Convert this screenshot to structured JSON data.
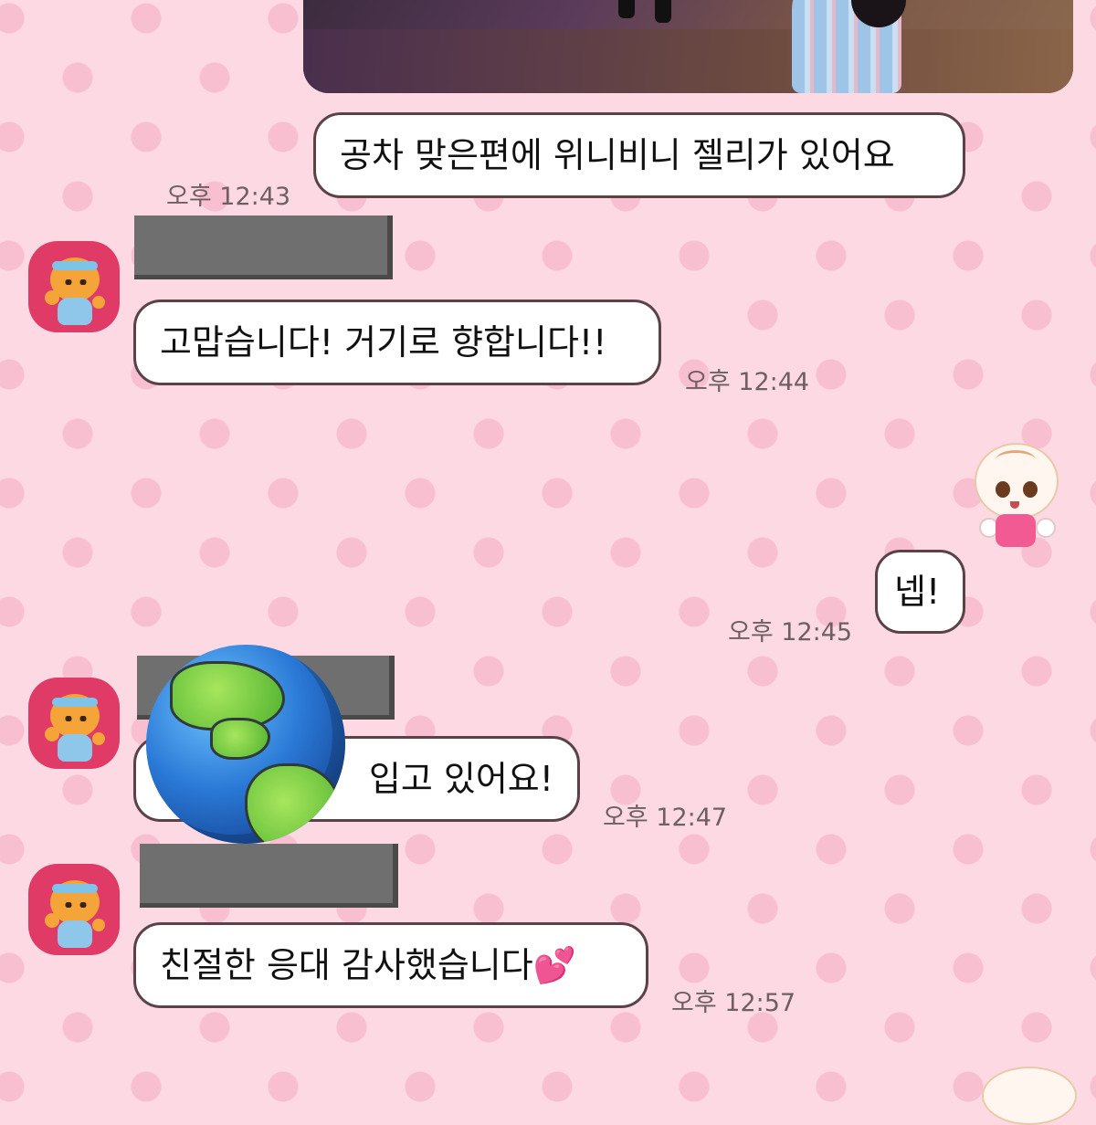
{
  "messages": [
    {
      "text": "공차 맞은편에 위니비니 젤리가 있어요",
      "time": "오후 12:43"
    },
    {
      "text": "고맙습니다! 거기로 향합니다!!",
      "time": "오후 12:44"
    },
    {
      "text": "넵!",
      "time": "오후 12:45"
    },
    {
      "text": "입고 있어요!",
      "time": "오후 12:47"
    },
    {
      "text": "친절한 응대 감사했습니다💕",
      "time": "오후 12:57"
    }
  ],
  "icons": {
    "avatar": "lion-character-avatar",
    "sticker": "angel-character-sticker",
    "overlay": "globe-emoji"
  },
  "colors": {
    "background": "#fcd9e3",
    "dots": "#f8bfd0",
    "bubble_border": "#5a4246",
    "avatar_bg": "#e03a67"
  }
}
